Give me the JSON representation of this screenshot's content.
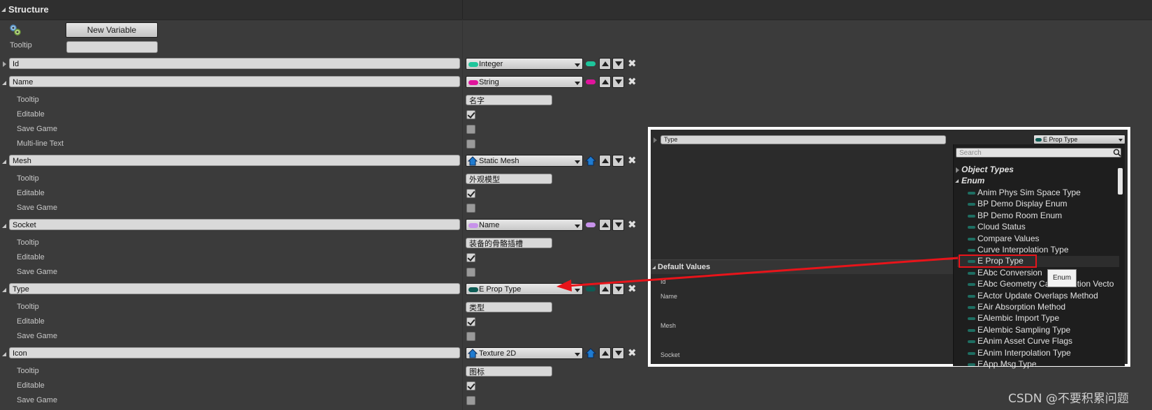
{
  "header": {
    "title": "Structure"
  },
  "top": {
    "new_variable_label": "New Variable",
    "tooltip_label": "Tooltip"
  },
  "variables": [
    {
      "name": "Id",
      "expanded": false,
      "type": "Integer",
      "type_color": "#1ec59b"
    },
    {
      "name": "Name",
      "expanded": true,
      "type": "String",
      "type_color": "#e0149c",
      "props": [
        {
          "label": "Tooltip",
          "kind": "text",
          "value": "名字"
        },
        {
          "label": "Editable",
          "kind": "check",
          "checked": true
        },
        {
          "label": "Save Game",
          "kind": "check",
          "checked": false
        },
        {
          "label": "Multi-line Text",
          "kind": "check",
          "checked": false
        }
      ]
    },
    {
      "name": "Mesh",
      "expanded": true,
      "type": "Static Mesh",
      "type_color": "#1f7bd0",
      "props": [
        {
          "label": "Tooltip",
          "kind": "text",
          "value": "外观模型"
        },
        {
          "label": "Editable",
          "kind": "check",
          "checked": true
        },
        {
          "label": "Save Game",
          "kind": "check",
          "checked": false
        }
      ]
    },
    {
      "name": "Socket",
      "expanded": true,
      "type": "Name",
      "type_color": "#c792ea",
      "props": [
        {
          "label": "Tooltip",
          "kind": "text",
          "value": "装备的骨骼插槽"
        },
        {
          "label": "Editable",
          "kind": "check",
          "checked": true
        },
        {
          "label": "Save Game",
          "kind": "check",
          "checked": false
        }
      ]
    },
    {
      "name": "Type",
      "expanded": true,
      "type": "E Prop Type",
      "type_color": "#0d5c55",
      "props": [
        {
          "label": "Tooltip",
          "kind": "text",
          "value": "类型"
        },
        {
          "label": "Editable",
          "kind": "check",
          "checked": true
        },
        {
          "label": "Save Game",
          "kind": "check",
          "checked": false
        }
      ]
    },
    {
      "name": "Icon",
      "expanded": true,
      "type": "Texture 2D",
      "type_color": "#1f7bd0",
      "props": [
        {
          "label": "Tooltip",
          "kind": "text",
          "value": "图标"
        },
        {
          "label": "Editable",
          "kind": "check",
          "checked": true
        },
        {
          "label": "Save Game",
          "kind": "check",
          "checked": false
        }
      ]
    }
  ],
  "inset": {
    "var_name": "Type",
    "var_type": "E Prop Type",
    "search_placeholder": "Search",
    "categories": [
      "Object Types",
      "Enum"
    ],
    "enum_items": [
      "Anim Phys Sim Space Type",
      "BP Demo Display Enum",
      "BP Demo Room Enum",
      "Cloud Status",
      "Compare Values",
      "Curve Interpolation Type",
      "E Prop Type",
      "EAbc Conversion",
      "EAbc Geometry Cache Motion Vecto",
      "EActor Update Overlaps Method",
      "EAir Absorption Method",
      "EAlembic Import Type",
      "EAlembic Sampling Type",
      "EAnim Asset Curve Flags",
      "EAnim Interpolation Type",
      "EApp Msg Type"
    ],
    "selected_item": "E Prop Type",
    "tooltip_text": "Enum",
    "default_values_label": "Default Values",
    "default_fields": [
      "Id",
      "Name",
      "Mesh",
      "Socket"
    ]
  },
  "annotation": {
    "color": "#e8141a"
  },
  "watermark": "CSDN @不要积累问题"
}
